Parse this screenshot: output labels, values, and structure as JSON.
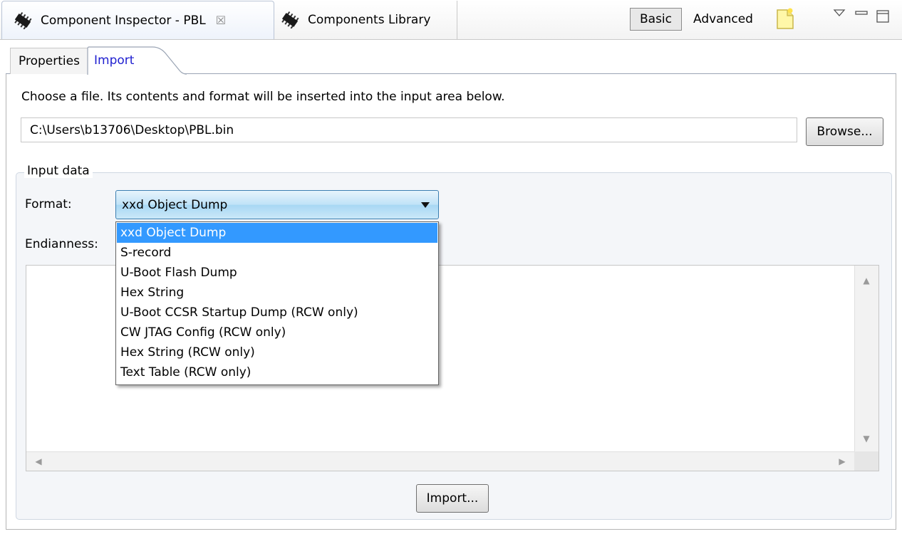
{
  "tabs": {
    "inspector": "Component Inspector - PBL",
    "library": "Components Library",
    "close_glyph": "☒"
  },
  "toolbar": {
    "basic": "Basic",
    "advanced": "Advanced"
  },
  "inner_tabs": {
    "properties": "Properties",
    "import": "Import"
  },
  "import_panel": {
    "instructions": "Choose a file. Its contents and format will be inserted into the input area below.",
    "file_path": "C:\\Users\\b13706\\Desktop\\PBL.bin",
    "browse": "Browse...",
    "group_label": "Input data",
    "format_label": "Format:",
    "format_selected": "xxd Object Dump",
    "endianness_label": "Endianness:",
    "import_button": "Import..."
  },
  "format_options": [
    "xxd Object Dump",
    "S-record",
    "U-Boot Flash Dump",
    "Hex String",
    "U-Boot CCSR Startup Dump (RCW only)",
    "CW JTAG Config (RCW only)",
    "Hex String (RCW only)",
    "Text Table (RCW only)"
  ],
  "colors": {
    "selection": "#3399ff",
    "link_tab": "#2020d0",
    "combo_border": "#3c7fb1"
  },
  "icons": [
    "chip-icon",
    "chip-icon",
    "close-icon",
    "new-note-icon",
    "view-menu-icon",
    "minimize-icon",
    "maximize-icon",
    "chevron-down-icon",
    "scroll-up-icon",
    "scroll-down-icon",
    "scroll-left-icon",
    "scroll-right-icon"
  ]
}
